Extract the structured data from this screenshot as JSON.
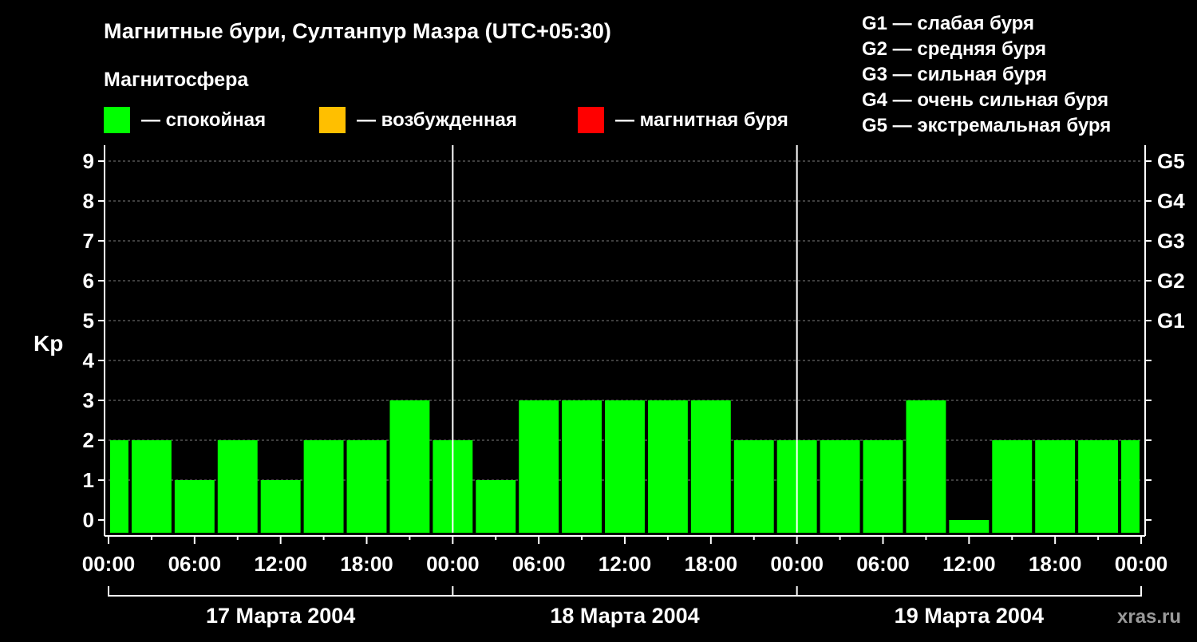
{
  "colors": {
    "background": "#000000",
    "quiet": "#00ff00",
    "active": "#ffbf00",
    "storm": "#ff0000",
    "text": "#ffffff",
    "grid": "#808080"
  },
  "header": {
    "title": "Магнитные бури, Султанпур Мазра (UTC+05:30)",
    "magnetosphere_label": "Магнитосфера"
  },
  "legend": [
    {
      "label": "— спокойная",
      "color": "#00ff00"
    },
    {
      "label": "— возбужденная",
      "color": "#ffbf00"
    },
    {
      "label": "— магнитная буря",
      "color": "#ff0000"
    }
  ],
  "storm_scale": [
    "G1 — слабая буря",
    "G2 — средняя буря",
    "G3 — сильная буря",
    "G4 — очень сильная буря",
    "G5 — экстремальная буря"
  ],
  "watermark": "xras.ru",
  "chart_data": {
    "type": "bar",
    "ylabel": "Kp",
    "ylim": [
      0,
      9
    ],
    "yticks": [
      "0",
      "1",
      "2",
      "3",
      "4",
      "5",
      "6",
      "7",
      "8",
      "9"
    ],
    "right_axis": [
      {
        "kp": 5,
        "label": "G1"
      },
      {
        "kp": 6,
        "label": "G2"
      },
      {
        "kp": 7,
        "label": "G3"
      },
      {
        "kp": 8,
        "label": "G4"
      },
      {
        "kp": 9,
        "label": "G5"
      }
    ],
    "xticks": [
      "00:00",
      "06:00",
      "12:00",
      "18:00",
      "00:00",
      "06:00",
      "12:00",
      "18:00",
      "00:00",
      "06:00",
      "12:00",
      "18:00",
      "00:00"
    ],
    "days": [
      "17 Марта 2004",
      "18 Марта 2004",
      "19 Марта 2004"
    ],
    "grid": "dashed horizontal",
    "bar_hours": 3,
    "bars": [
      {
        "start_hour": 0.0,
        "end_hour": 1.5,
        "kp": 2
      },
      {
        "start_hour": 1.5,
        "end_hour": 4.5,
        "kp": 2
      },
      {
        "start_hour": 4.5,
        "end_hour": 7.5,
        "kp": 1
      },
      {
        "start_hour": 7.5,
        "end_hour": 10.5,
        "kp": 2
      },
      {
        "start_hour": 10.5,
        "end_hour": 13.5,
        "kp": 1
      },
      {
        "start_hour": 13.5,
        "end_hour": 16.5,
        "kp": 2
      },
      {
        "start_hour": 16.5,
        "end_hour": 19.5,
        "kp": 2
      },
      {
        "start_hour": 19.5,
        "end_hour": 22.5,
        "kp": 3
      },
      {
        "start_hour": 22.5,
        "end_hour": 25.5,
        "kp": 2
      },
      {
        "start_hour": 25.5,
        "end_hour": 28.5,
        "kp": 1
      },
      {
        "start_hour": 28.5,
        "end_hour": 31.5,
        "kp": 3
      },
      {
        "start_hour": 31.5,
        "end_hour": 34.5,
        "kp": 3
      },
      {
        "start_hour": 34.5,
        "end_hour": 37.5,
        "kp": 3
      },
      {
        "start_hour": 37.5,
        "end_hour": 40.5,
        "kp": 3
      },
      {
        "start_hour": 40.5,
        "end_hour": 43.5,
        "kp": 3
      },
      {
        "start_hour": 43.5,
        "end_hour": 46.5,
        "kp": 2
      },
      {
        "start_hour": 46.5,
        "end_hour": 49.5,
        "kp": 2
      },
      {
        "start_hour": 49.5,
        "end_hour": 52.5,
        "kp": 2
      },
      {
        "start_hour": 52.5,
        "end_hour": 55.5,
        "kp": 2
      },
      {
        "start_hour": 55.5,
        "end_hour": 58.5,
        "kp": 3
      },
      {
        "start_hour": 58.5,
        "end_hour": 61.5,
        "kp": 0
      },
      {
        "start_hour": 61.5,
        "end_hour": 64.5,
        "kp": 2
      },
      {
        "start_hour": 64.5,
        "end_hour": 67.5,
        "kp": 2
      },
      {
        "start_hour": 67.5,
        "end_hour": 70.5,
        "kp": 2
      },
      {
        "start_hour": 70.5,
        "end_hour": 72.0,
        "kp": 2
      }
    ]
  }
}
